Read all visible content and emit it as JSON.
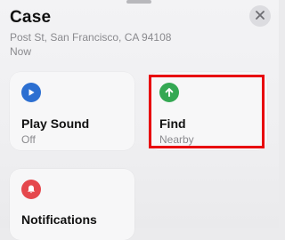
{
  "header": {
    "title": "Case",
    "address": "Post St, San Francisco, CA 94108",
    "time": "Now"
  },
  "actions": [
    {
      "label": "Play Sound",
      "sub": "Off",
      "icon": "play-icon",
      "color": "#2c6fd1"
    },
    {
      "label": "Find",
      "sub": "Nearby",
      "icon": "arrow-up-icon",
      "color": "#34a853"
    },
    {
      "label": "Notifications",
      "sub": "",
      "icon": "bell-icon",
      "color": "#e5484d"
    }
  ],
  "colors": {
    "highlight": "#e8000d",
    "close_background": "#dcdce0"
  }
}
